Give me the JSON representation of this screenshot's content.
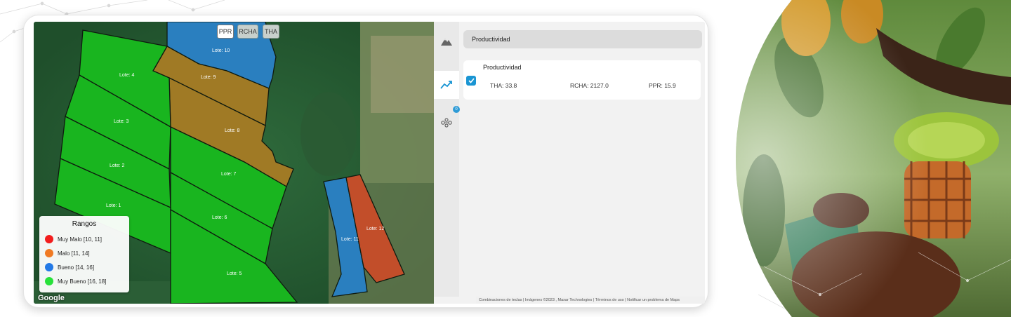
{
  "map": {
    "layer_toggles": [
      "PPR",
      "RCHA",
      "THA"
    ],
    "active_toggle": "PPR",
    "lots": [
      {
        "label": "Lote: 10",
        "status": "Bueno"
      },
      {
        "label": "Lote: 9",
        "status": "Malo"
      },
      {
        "label": "Lote: 8",
        "status": "Malo"
      },
      {
        "label": "Lote: 4",
        "status": "Muy Bueno"
      },
      {
        "label": "Lote: 3",
        "status": "Muy Bueno"
      },
      {
        "label": "Lote: 2",
        "status": "Muy Bueno"
      },
      {
        "label": "Lote: 1",
        "status": "Muy Bueno"
      },
      {
        "label": "Lote: 7",
        "status": "Muy Bueno"
      },
      {
        "label": "Lote: 6",
        "status": "Muy Bueno"
      },
      {
        "label": "Lote: 5",
        "status": "Muy Bueno"
      },
      {
        "label": "Lote: 11",
        "status": "Bueno"
      },
      {
        "label": "Lote: 12",
        "status": "Malo"
      }
    ],
    "legend": {
      "title": "Rangos",
      "items": [
        {
          "label": "Muy Malo [10, 11]",
          "color": "#f21d1d"
        },
        {
          "label": "Malo [11, 14]",
          "color": "#f07a24"
        },
        {
          "label": "Bueno [14, 16]",
          "color": "#2379e6"
        },
        {
          "label": "Muy Bueno [16, 18]",
          "color": "#28e13a"
        }
      ]
    },
    "provider_logo": "Google",
    "attribution": "Combinaciones de teclas | Imágenes ©2023 , Maxar Technologies | Términos de uso | Notificar un problema de Maps"
  },
  "panel": {
    "search_value": "Productividad",
    "rail_badge": "0",
    "card": {
      "title": "Productividad",
      "checked": true,
      "metrics": [
        {
          "label": "THA: 33.8"
        },
        {
          "label": "RCHA: 2127.0"
        },
        {
          "label": "PPR: 15.9"
        }
      ]
    }
  },
  "colors": {
    "accent": "#1a95d3",
    "lot_green": "#19b51f",
    "lot_brown": "#a07a25",
    "lot_blue": "#2a7fbf",
    "lot_red": "#c24e2a"
  }
}
